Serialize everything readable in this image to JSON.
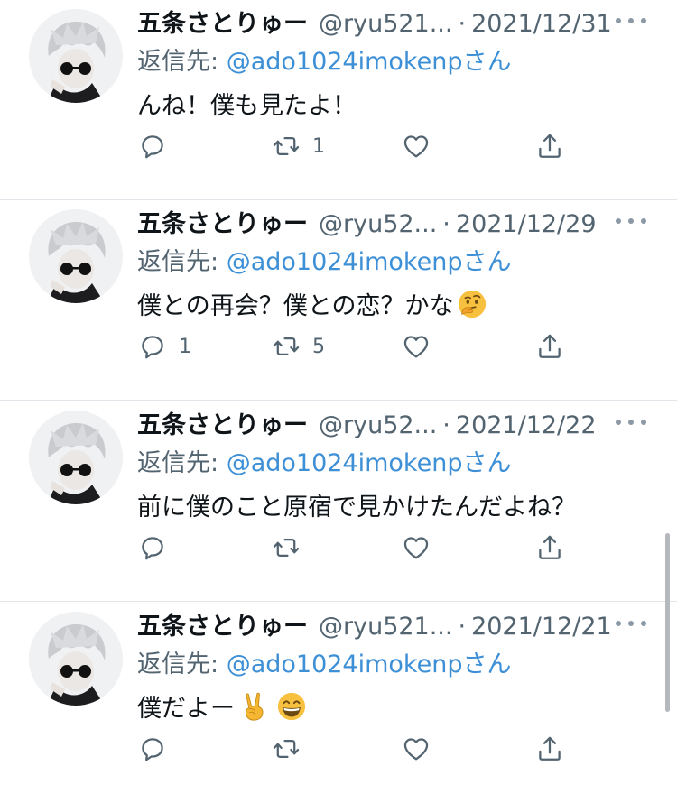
{
  "icons": {
    "reply": "reply-icon",
    "retweet": "retweet-icon",
    "like": "heart-icon",
    "share": "share-icon",
    "more": "more-icon"
  },
  "colors": {
    "mention": "#3d8fd6",
    "secondary_text": "#536471",
    "primary_text": "#0f1419"
  },
  "tweets": [
    {
      "name": "五条さとりゅー",
      "handle": "@ryu521...",
      "date": "2021/12/31",
      "reply_prefix": "返信先: ",
      "reply_mention": "@ado1024imokenp",
      "reply_suffix": "さん",
      "text": "んね！僕も見たよ！",
      "emojis": [],
      "reply_count": "",
      "retweet_count": "1"
    },
    {
      "name": "五条さとりゅー",
      "handle": "@ryu52...",
      "date": "2021/12/29",
      "reply_prefix": "返信先: ",
      "reply_mention": "@ado1024imokenp",
      "reply_suffix": "さん",
      "text": "僕との再会？僕との恋？かな",
      "emojis": [
        "thinking-face-emoji"
      ],
      "reply_count": "1",
      "retweet_count": "5"
    },
    {
      "name": "五条さとりゅー",
      "handle": "@ryu52...",
      "date": "2021/12/22",
      "reply_prefix": "返信先: ",
      "reply_mention": "@ado1024imokenp",
      "reply_suffix": "さん",
      "text": "前に僕のこと原宿で見かけたんだよね？",
      "emojis": [],
      "reply_count": "",
      "retweet_count": ""
    },
    {
      "name": "五条さとりゅー",
      "handle": "@ryu521...",
      "date": "2021/12/21",
      "reply_prefix": "返信先: ",
      "reply_mention": "@ado1024imokenp",
      "reply_suffix": "さん",
      "text": "僕だよー",
      "emojis": [
        "victory-hand-emoji",
        "grinning-face-emoji"
      ],
      "reply_count": "",
      "retweet_count": ""
    }
  ]
}
